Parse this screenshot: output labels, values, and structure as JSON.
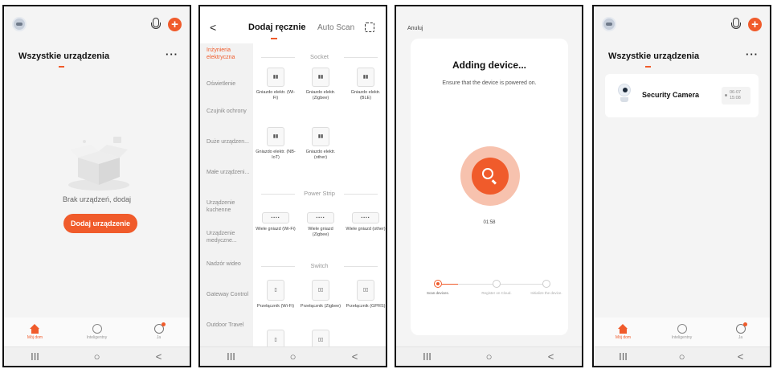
{
  "colors": {
    "accent": "#f05b2b",
    "background": "#f4f4f4"
  },
  "system_nav": {
    "recents": "III",
    "home": "○",
    "back": "<"
  },
  "home_empty": {
    "title": "Wszystkie urządzenia",
    "more": "···",
    "empty_text": "Brak urządzeń, dodaj",
    "add_button": "Dodaj urządzenie",
    "tabs": [
      "Mój dom",
      "Inteligentny",
      "Ja"
    ]
  },
  "add_manual": {
    "back": "<",
    "tab_manual": "Dodaj ręcznie",
    "tab_auto": "Auto Scan",
    "categories": [
      "Inżynieria elektryczna",
      "Oświetlenie",
      "Czujnik ochrony",
      "Duże urządzen...",
      "Małe urządzeni...",
      "Urządzenie kuchenne",
      "Urządzenie medyczne...",
      "Nadzór wideo",
      "Gateway Control",
      "Outdoor Travel"
    ],
    "sections": {
      "socket": {
        "title": "Socket",
        "items": [
          "Gniazdo elektr. (Wi-Fi)",
          "Gniazdo elektr. (Zigbee)",
          "Gniazdo elektr. (BLE)",
          "Gniazdo elektr. (NB-IoT)",
          "Gniazdo elektr. (other)"
        ]
      },
      "strip": {
        "title": "Power Strip",
        "items": [
          "Wiele gniazd (Wi-Fi)",
          "Wiele gniazd (Zigbee)",
          "Wiele gniazd (other)"
        ]
      },
      "switch": {
        "title": "Switch",
        "items": [
          "Przełącznik (Wi-Fi)",
          "Przełącznik (Zigbee)",
          "Przełącznik (GPRS)"
        ]
      }
    }
  },
  "adding": {
    "cancel": "Anuluj",
    "title": "Adding device...",
    "subtitle": "Ensure that the device is powered on.",
    "timer": "01:58",
    "steps": [
      "Scan devices.",
      "Register on Cloud.",
      "Initialize the device."
    ]
  },
  "home_device": {
    "title": "Wszystkie urządzenia",
    "more": "···",
    "device_name": "Security Camera",
    "device_date": "06-07",
    "device_time": "15:08",
    "tabs": [
      "Mój dom",
      "Inteligentny",
      "Ja"
    ]
  }
}
